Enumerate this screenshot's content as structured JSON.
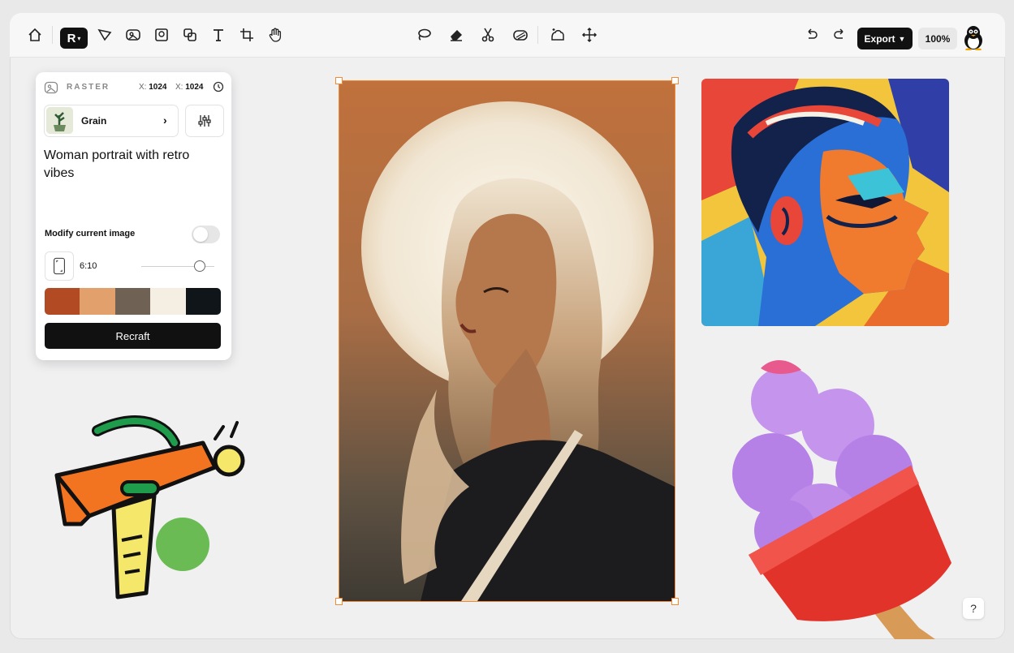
{
  "toolbar": {
    "left_tools": [
      "home-icon",
      "logo-menu",
      "pen-tool-icon",
      "image-icon",
      "frame-image-icon",
      "layers-icon",
      "text-icon",
      "crop-icon",
      "hand-icon"
    ],
    "center_tools": [
      "lasso-icon",
      "eraser-icon",
      "scissors-icon",
      "vectorize-icon",
      "remove-bg-icon",
      "move-icon"
    ],
    "right_tools": [
      "undo-icon",
      "redo-icon"
    ],
    "export_label": "Export",
    "zoom_label": "100%"
  },
  "panel": {
    "mode_label": "RASTER",
    "width_prefix": "X:",
    "width_value": "1024",
    "height_prefix": "X:",
    "height_value": "1024",
    "style_name": "Grain",
    "prompt": "Woman portrait with retro vibes",
    "modify_label": "Modify current image",
    "modify_enabled": false,
    "ratio_label": "6:10",
    "palette": [
      "#b24a23",
      "#e2a06c",
      "#6f6254",
      "#f5efe3",
      "#0f1519"
    ],
    "recraft_label": "Recraft"
  },
  "help_label": "?"
}
